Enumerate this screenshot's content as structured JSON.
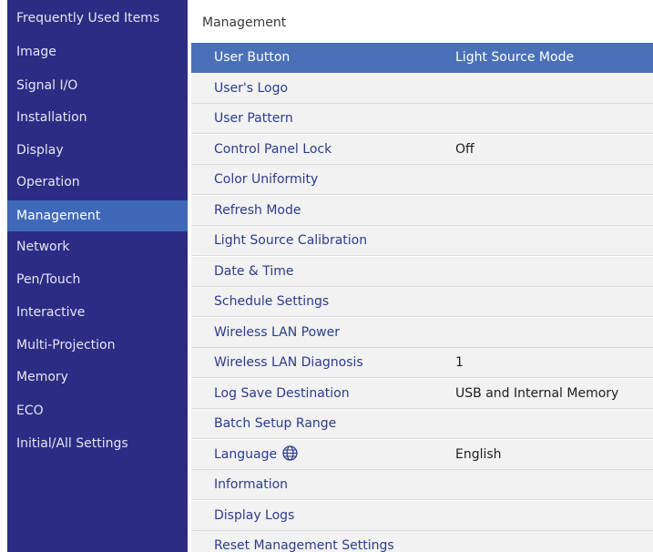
{
  "sidebar": {
    "items": [
      {
        "label": "Frequently Used Items"
      },
      {
        "label": "Image"
      },
      {
        "label": "Signal I/O"
      },
      {
        "label": "Installation"
      },
      {
        "label": "Display"
      },
      {
        "label": "Operation"
      },
      {
        "label": "Management",
        "selected": true
      },
      {
        "label": "Network"
      },
      {
        "label": "Pen/Touch"
      },
      {
        "label": "Interactive"
      },
      {
        "label": "Multi-Projection"
      },
      {
        "label": "Memory"
      },
      {
        "label": "ECO"
      },
      {
        "label": "Initial/All Settings"
      }
    ]
  },
  "main": {
    "title": "Management",
    "rows": [
      {
        "label": "User Button",
        "value": "Light Source Mode",
        "selected": true
      },
      {
        "label": "User's Logo",
        "value": ""
      },
      {
        "label": "User Pattern",
        "value": ""
      },
      {
        "label": "Control Panel Lock",
        "value": "Off"
      },
      {
        "label": "Color Uniformity",
        "value": ""
      },
      {
        "label": "Refresh Mode",
        "value": ""
      },
      {
        "label": "Light Source Calibration",
        "value": ""
      },
      {
        "label": "Date & Time",
        "value": ""
      },
      {
        "label": "Schedule Settings",
        "value": ""
      },
      {
        "label": "Wireless LAN Power",
        "value": ""
      },
      {
        "label": "Wireless LAN Diagnosis",
        "value": "1"
      },
      {
        "label": "Log Save Destination",
        "value": "USB and Internal Memory"
      },
      {
        "label": "Batch Setup Range",
        "value": ""
      },
      {
        "label": "Language",
        "value": "English",
        "icon": "globe-icon"
      },
      {
        "label": "Information",
        "value": ""
      },
      {
        "label": "Display Logs",
        "value": ""
      },
      {
        "label": "Reset Management Settings",
        "value": ""
      }
    ]
  },
  "colors": {
    "sidebar_bg": "#2c2c84",
    "selection": "#4a71b8",
    "row_text": "#2c3c8c"
  }
}
